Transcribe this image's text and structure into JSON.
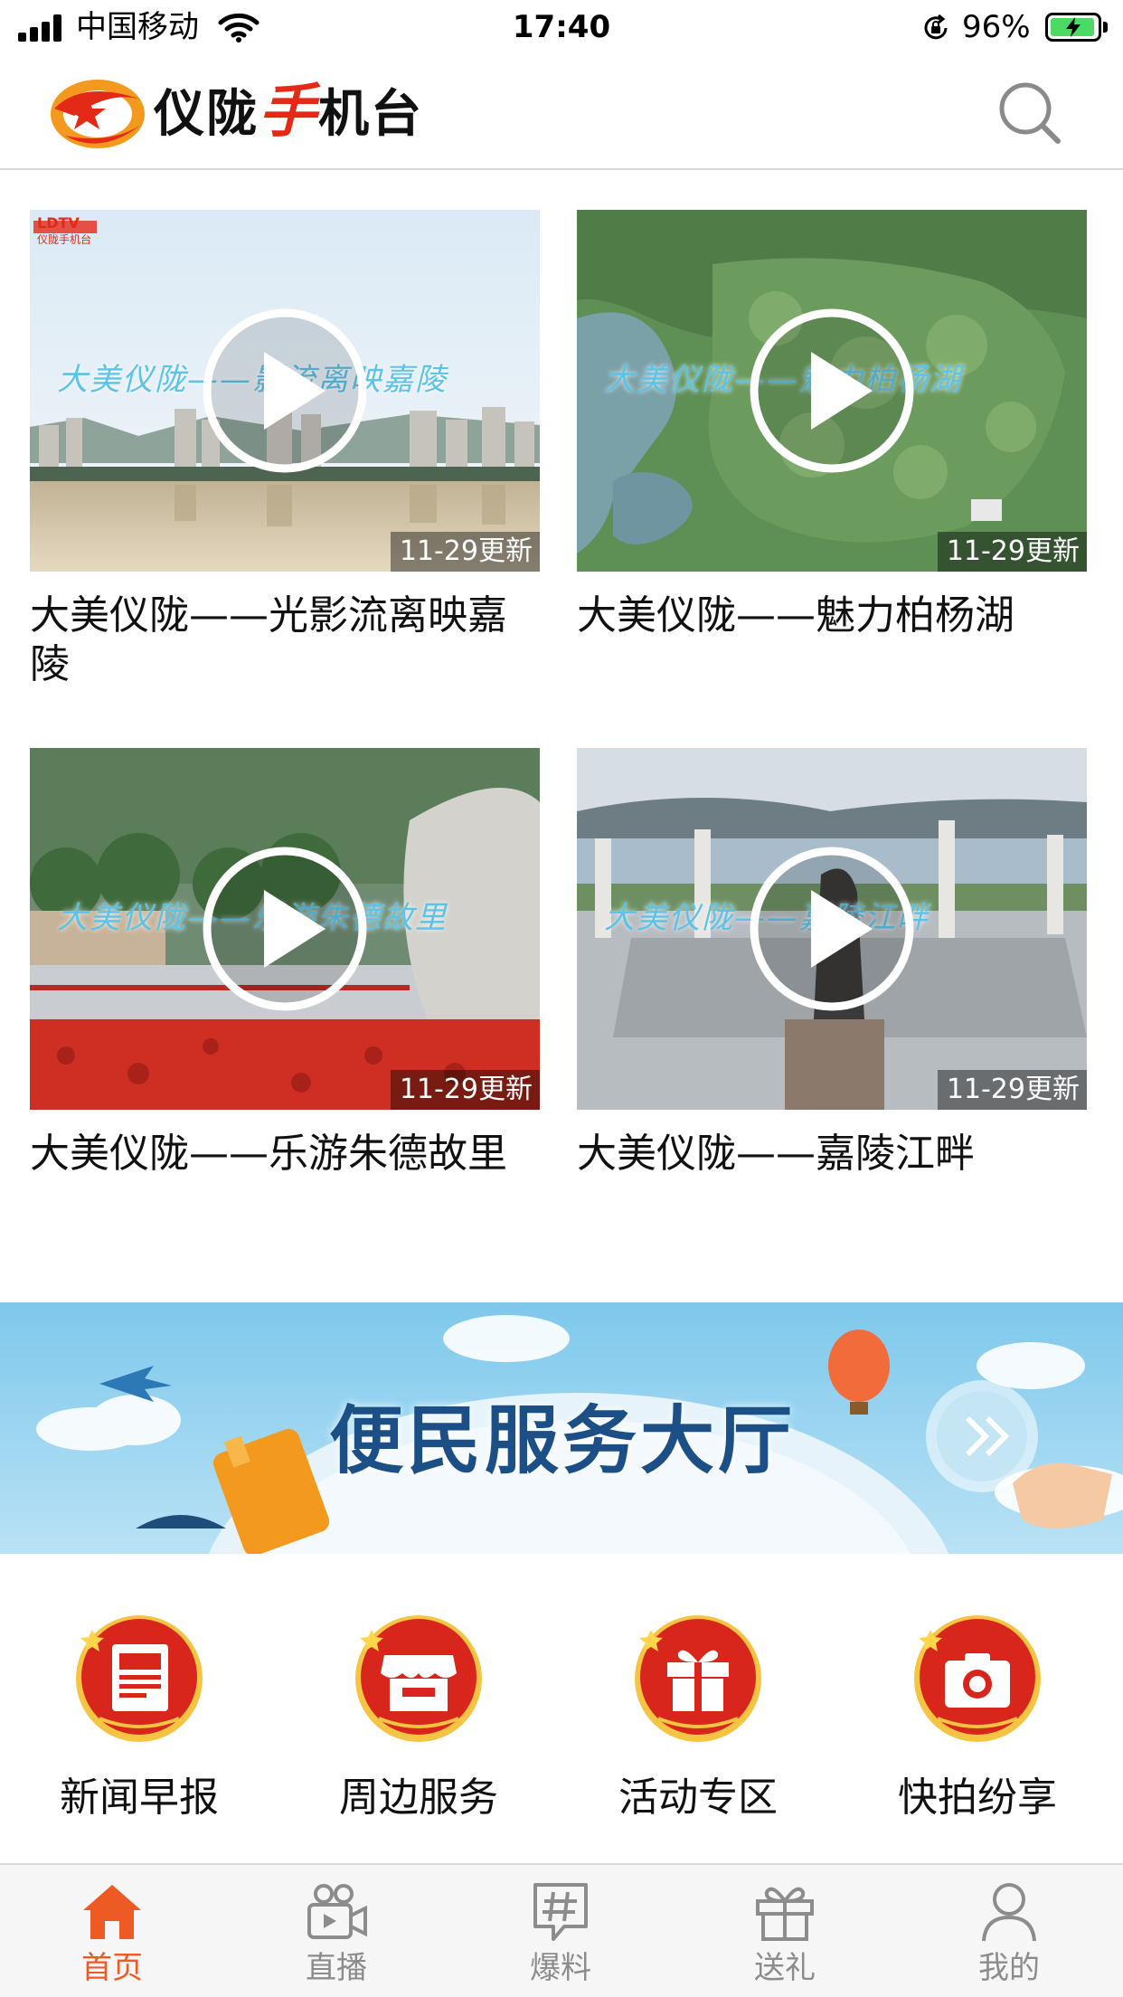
{
  "status_bar": {
    "carrier": "中国移动",
    "time": "17:40",
    "battery_percent": "96%"
  },
  "header": {
    "logo_text_a": "仪陇",
    "logo_text_hand": "手",
    "logo_text_b": "机台"
  },
  "videos": [
    {
      "title": "大美仪陇——光影流离映嘉陵",
      "overlay_caption": "大美仪陇——影流离映嘉陵",
      "update_label": "11-29更新",
      "corner_mark": "LDTV",
      "corner_mark_sub": "仪陇手机台"
    },
    {
      "title": "大美仪陇——魅力柏杨湖",
      "overlay_caption": "大美仪陇——魅力柏杨湖",
      "update_label": "11-29更新"
    },
    {
      "title": "大美仪陇——乐游朱德故里",
      "overlay_caption": "大美仪陇——乐游朱德故里",
      "update_label": "11-29更新"
    },
    {
      "title": "大美仪陇——嘉陵江畔",
      "overlay_caption": "大美仪陇——嘉陵江畔",
      "update_label": "11-29更新"
    }
  ],
  "banner": {
    "title": "便民服务大厅"
  },
  "services": [
    {
      "label": "新闻早报",
      "icon": "newspaper-icon"
    },
    {
      "label": "周边服务",
      "icon": "shop-icon"
    },
    {
      "label": "活动专区",
      "icon": "gift-icon"
    },
    {
      "label": "快拍纷享",
      "icon": "camera-icon"
    }
  ],
  "tabs": [
    {
      "label": "首页",
      "icon": "home-icon",
      "active": true
    },
    {
      "label": "直播",
      "icon": "live-camera-icon",
      "active": false
    },
    {
      "label": "爆料",
      "icon": "hashtag-chat-icon",
      "active": false
    },
    {
      "label": "送礼",
      "icon": "gift-icon",
      "active": false
    },
    {
      "label": "我的",
      "icon": "user-icon",
      "active": false
    }
  ],
  "colors": {
    "accent": "#ee5a24",
    "tab_inactive": "#8c8c8c",
    "service_red": "#d8261c",
    "banner_title": "#1b4f86"
  }
}
